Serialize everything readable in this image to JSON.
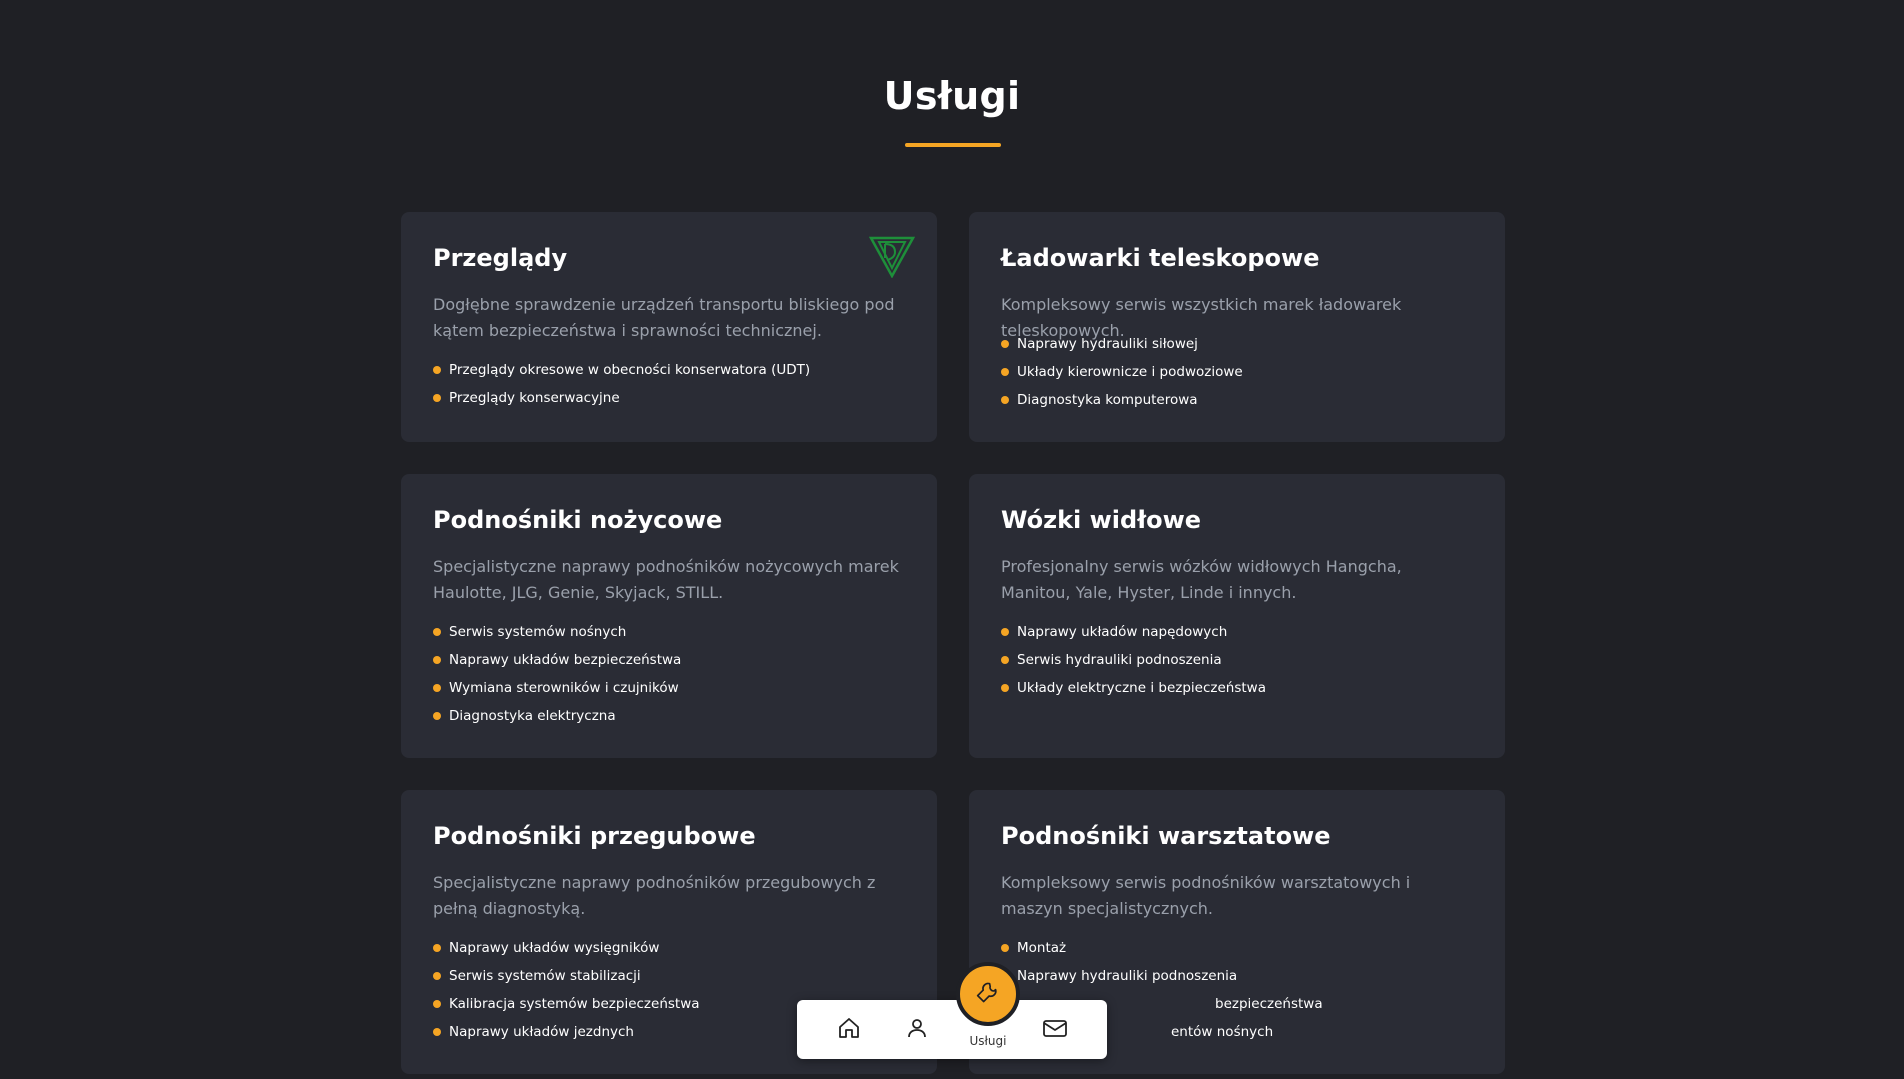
{
  "section": {
    "title": "Usługi",
    "accent_color": "#f5a524"
  },
  "cards": [
    {
      "title": "Przeglądy",
      "description": "Dogłębne sprawdzenie urządzeń transportu bliskiego pod kątem bezpieczeństwa i sprawności technicznej.",
      "logo_icon": "udt-logo-icon",
      "items": [
        "Przeglądy okresowe w obecności konserwatora (UDT)",
        "Przeglądy konserwacyjne"
      ]
    },
    {
      "title": "Ładowarki teleskopowe",
      "description": "Kompleksowy serwis wszystkich marek ładowarek teleskopowych.",
      "items": [
        "Naprawy hydrauliki siłowej",
        "Układy kierownicze i podwoziowe",
        "Diagnostyka komputerowa"
      ]
    },
    {
      "title": "Podnośniki nożycowe",
      "description": "Specjalistyczne naprawy podnośników nożycowych marek Haulotte, JLG, Genie, Skyjack, STILL.",
      "items": [
        "Serwis systemów nośnych",
        "Naprawy układów bezpieczeństwa",
        "Wymiana sterowników i czujników",
        "Diagnostyka elektryczna"
      ]
    },
    {
      "title": "Wózki widłowe",
      "description": "Profesjonalny serwis wózków widłowych Hangcha, Manitou, Yale, Hyster, Linde i innych.",
      "items": [
        "Naprawy układów napędowych",
        "Serwis hydrauliki podnoszenia",
        "Układy elektryczne i bezpieczeństwa"
      ]
    },
    {
      "title": "Podnośniki przegubowe",
      "description": "Specjalistyczne naprawy podnośników przegubowych z pełną diagnostyką.",
      "items": [
        "Naprawy układów wysięgników",
        "Serwis systemów stabilizacji",
        "Kalibracja systemów bezpieczeństwa",
        "Naprawy układów jezdnych"
      ]
    },
    {
      "title": "Podnośniki warsztatowe",
      "description": "Kompleksowy serwis podnośników warsztatowych i maszyn specjalistycznych.",
      "items": [
        "Montaż",
        "Naprawy hydrauliki podnoszenia",
        "bezpieczeństwa",
        "entów nośnych"
      ]
    }
  ],
  "bottom_nav": {
    "items": [
      {
        "icon": "home-icon"
      },
      {
        "icon": "user-icon"
      },
      {
        "icon": "wrench-icon",
        "label": "Usługi",
        "active": true
      },
      {
        "icon": "mail-icon"
      }
    ]
  }
}
